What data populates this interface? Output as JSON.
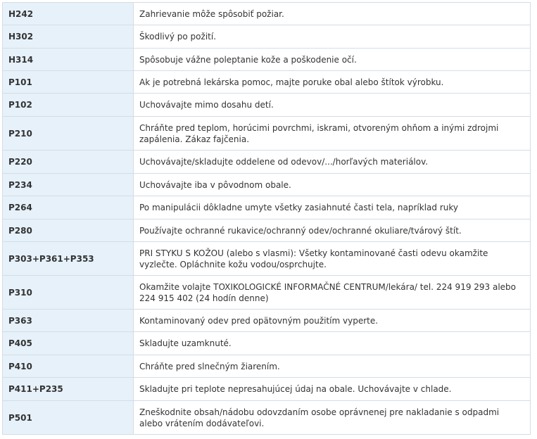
{
  "rows": [
    {
      "code": "H242",
      "text": "Zahrievanie môže spôsobiť požiar."
    },
    {
      "code": "H302",
      "text": "Škodlivý po požití."
    },
    {
      "code": "H314",
      "text": "Spôsobuje vážne poleptanie kože a poškodenie očí."
    },
    {
      "code": "P101",
      "text": "Ak je potrebná lekárska pomoc, majte poruke obal alebo štítok výrobku."
    },
    {
      "code": "P102",
      "text": "Uchovávajte mimo dosahu detí."
    },
    {
      "code": "P210",
      "text": "Chráňte pred teplom, horúcimi povrchmi, iskrami, otvoreným ohňom a inými zdrojmi zapálenia. Zákaz fajčenia."
    },
    {
      "code": "P220",
      "text": "Uchovávajte/skladujte oddelene od odevov/.../horľavých materiálov."
    },
    {
      "code": "P234",
      "text": "Uchovávajte iba v pôvodnom obale."
    },
    {
      "code": "P264",
      "text": "Po manipulácii dôkladne umyte všetky zasiahnuté časti tela, napríklad ruky"
    },
    {
      "code": "P280",
      "text": "Používajte ochranné rukavice/ochranný odev/ochranné okuliare/tvárový štít."
    },
    {
      "code": "P303+P361+P353",
      "text": "PRI STYKU S KOŽOU (alebo s vlasmi): Všetky kontaminované časti odevu okamžite vyzlečte. Opláchnite kožu vodou/osprchujte."
    },
    {
      "code": "P310",
      "text": "Okamžite volajte TOXIKOLOGICKÉ INFORMAČNÉ CENTRUM/lekára/ tel. 224 919 293 alebo 224 915 402 (24 hodín denne)"
    },
    {
      "code": "P363",
      "text": "Kontaminovaný odev pred opätovným použitím vyperte."
    },
    {
      "code": "P405",
      "text": "Skladujte uzamknuté."
    },
    {
      "code": "P410",
      "text": "Chráňte pred slnečným žiarením."
    },
    {
      "code": "P411+P235",
      "text": "Skladujte pri teplote nepresahujúcej údaj na obale. Uchovávajte v chlade."
    },
    {
      "code": "P501",
      "text": "Zneškodnite obsah/nádobu odovzdaním osobe oprávnenej pre nakladanie s odpadmi alebo vrátením dodávateľovi."
    }
  ]
}
